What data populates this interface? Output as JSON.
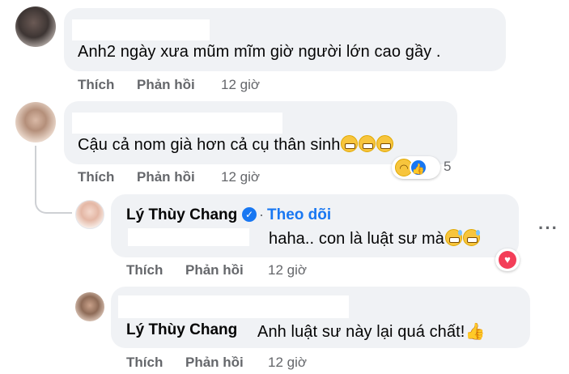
{
  "comments": [
    {
      "text": "Anh2 ngày xưa mũm mĩm giờ người lớn cao gầy .",
      "like_label": "Thích",
      "reply_label": "Phản hồi",
      "time": "12 giờ"
    },
    {
      "text": "Cậu cả nom già hơn cả cụ thân sinh",
      "like_label": "Thích",
      "reply_label": "Phản hồi",
      "time": "12 giờ",
      "reaction_count": "5"
    }
  ],
  "replies": [
    {
      "author": "Lý Thùy Chang",
      "follow_label": "Theo dõi",
      "separator": "·",
      "text": "haha.. con là luật sư mà",
      "like_label": "Thích",
      "reply_label": "Phản hồi",
      "time": "12 giờ"
    },
    {
      "author": "Lý Thùy Chang",
      "text": "Anh luật sư này lại quá chất!",
      "like_label": "Thích",
      "reply_label": "Phản hồi",
      "time": "12 giờ"
    }
  ],
  "icons": {
    "verified": "verified-badge-icon",
    "more": "more-options-icon",
    "haha": "haha-reaction-icon",
    "like": "like-reaction-icon",
    "love": "love-reaction-icon",
    "thumbs_up": "thumbs-up-emoji"
  },
  "colors": {
    "bubble": "#f0f2f5",
    "accent": "#1877f2",
    "muted": "#65676b"
  }
}
